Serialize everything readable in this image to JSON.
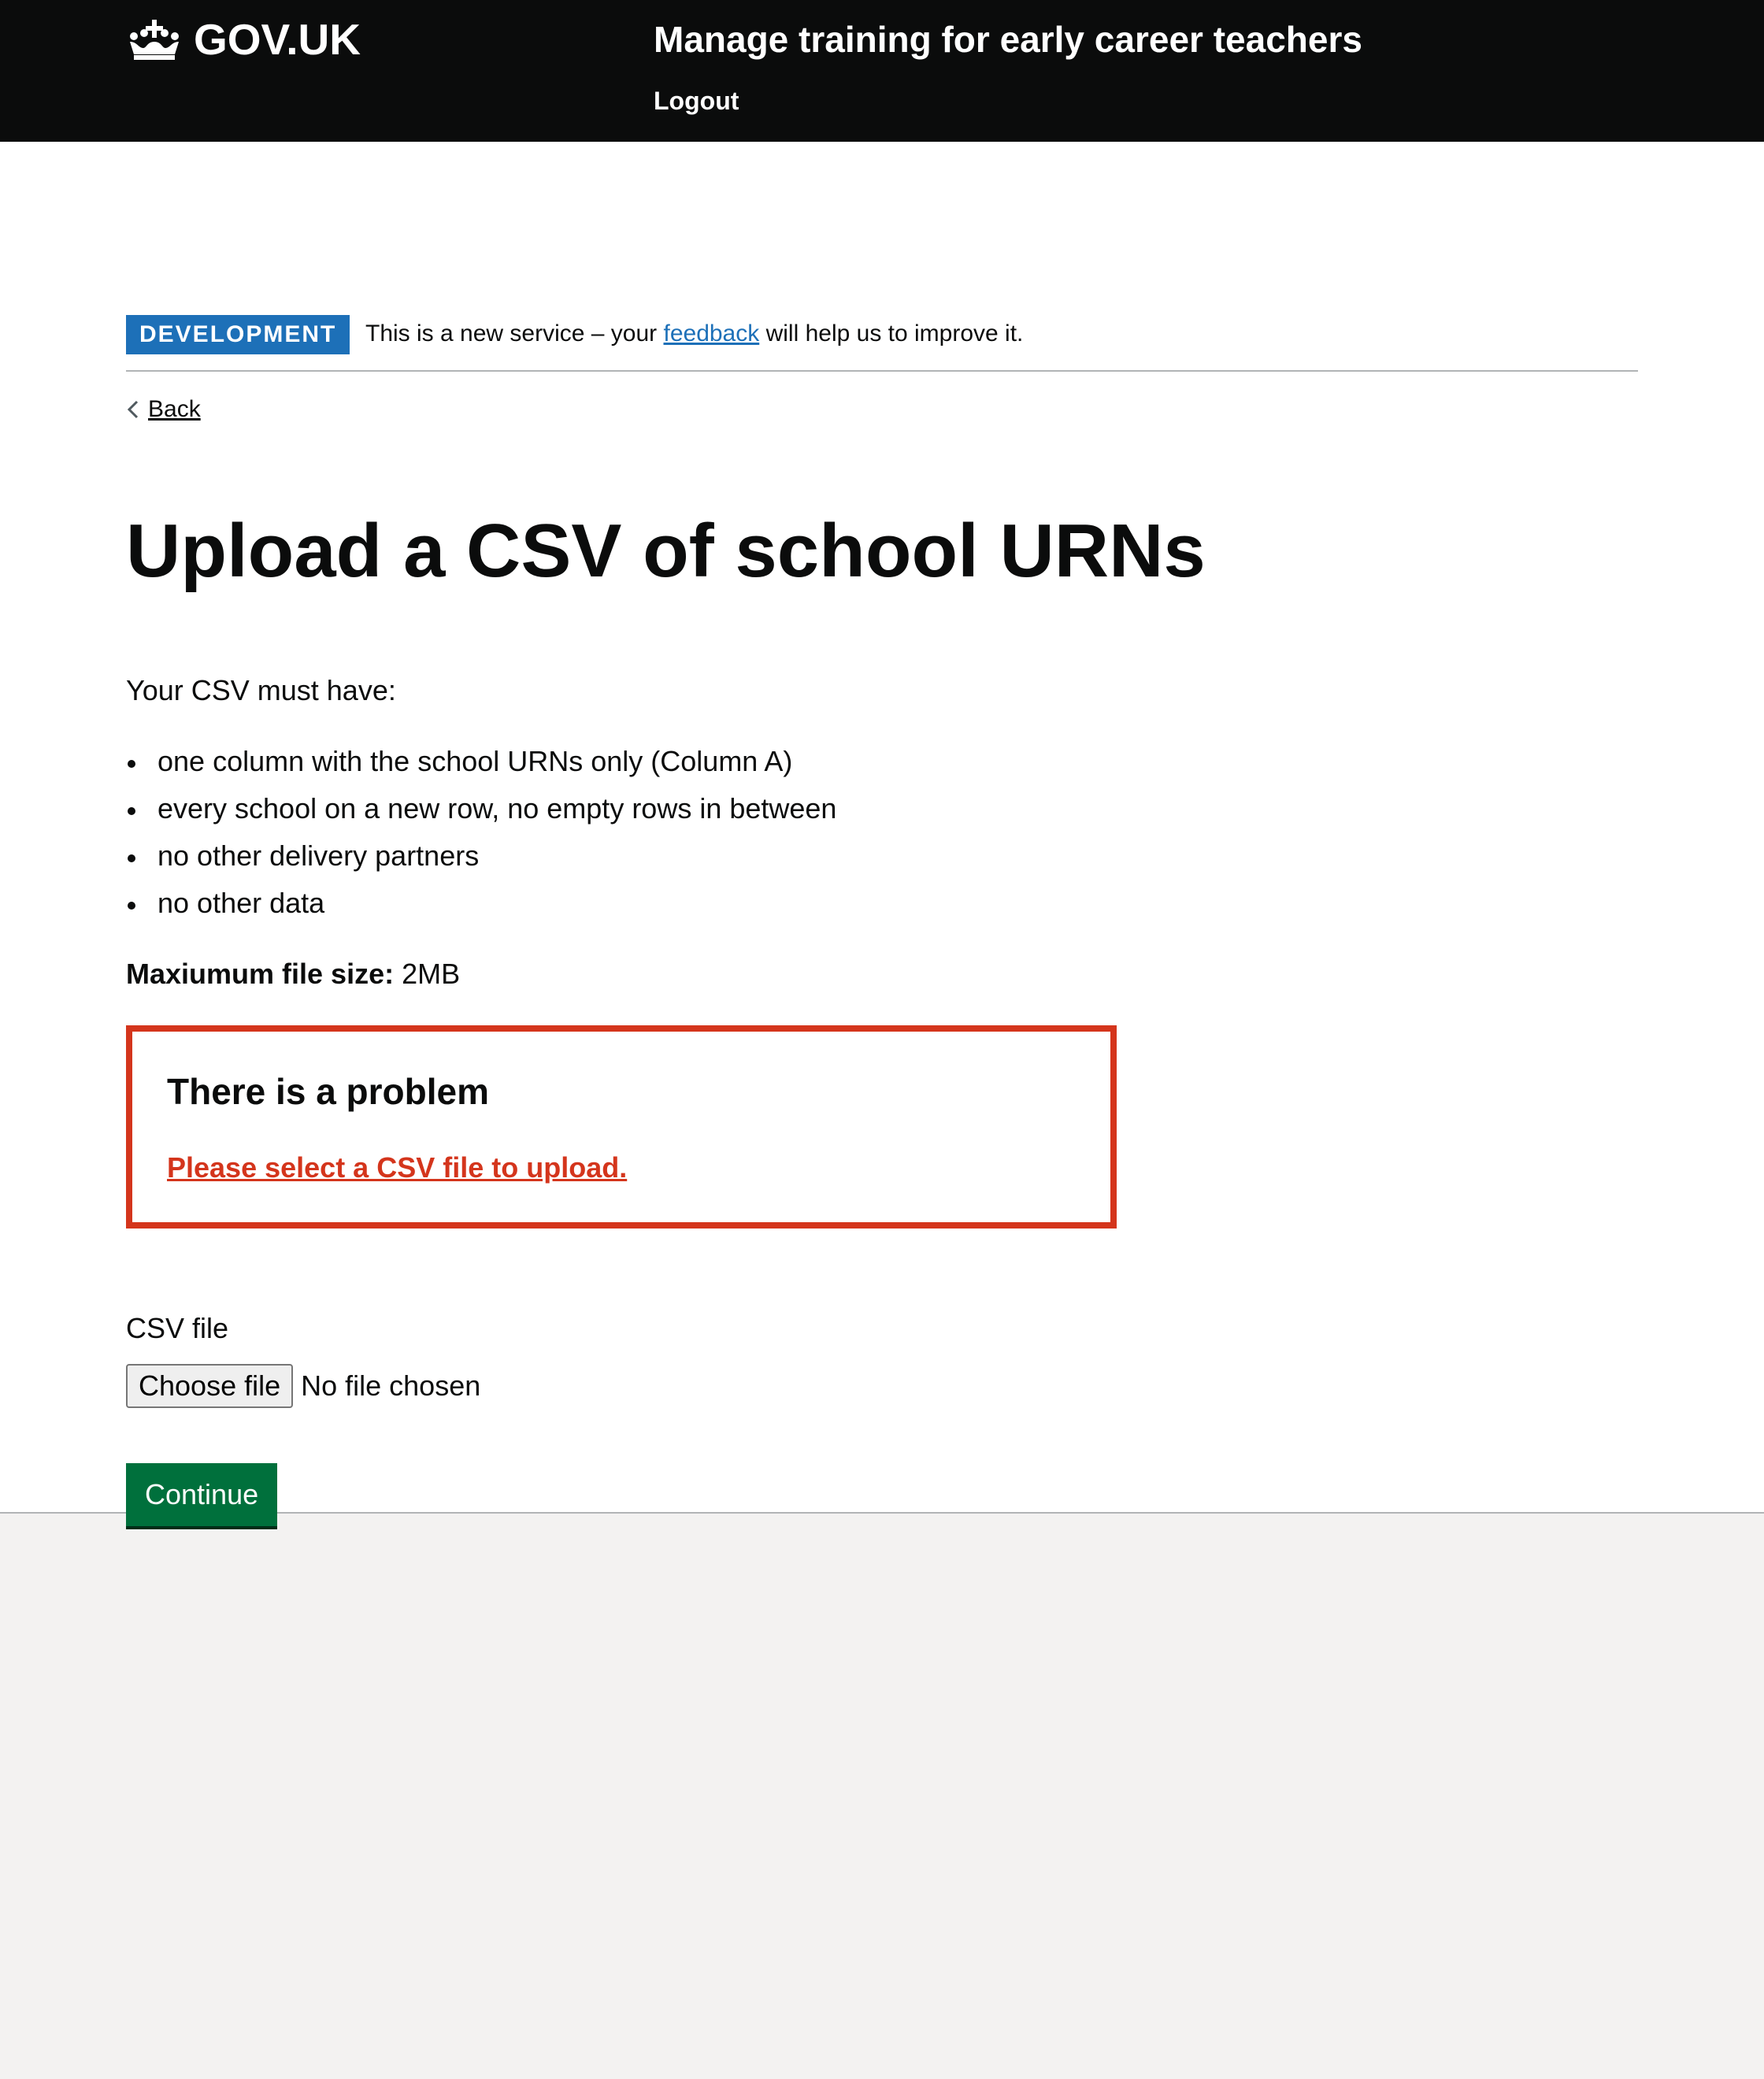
{
  "header": {
    "logo_text": "GOV.UK",
    "service_name": "Manage training for early career teachers",
    "logout_label": "Logout"
  },
  "phase_banner": {
    "tag": "DEVELOPMENT",
    "text_before": "This is a new service – your ",
    "feedback_link": "feedback",
    "text_after": " will help us to improve it."
  },
  "back_link": "Back",
  "page": {
    "title": "Upload a CSV of school URNs",
    "intro": "Your CSV must have:",
    "requirements": [
      "one column with the school URNs only (Column A)",
      "every school on a new row, no empty rows in between",
      "no other delivery partners",
      "no other data"
    ],
    "max_size_label": "Maxiumum file size:",
    "max_size_value": " 2MB"
  },
  "error_summary": {
    "title": "There is a problem",
    "message": "Please select a CSV file to upload."
  },
  "file_upload": {
    "label": "CSV file",
    "button_label": "Choose file",
    "status": "No file chosen"
  },
  "continue_label": "Continue",
  "colors": {
    "header_background": "#0b0c0c",
    "brand_blue": "#1d70b8",
    "error_red": "#d4351c",
    "button_green": "#00703c",
    "footer_background": "#f3f2f1"
  },
  "icons": {
    "logo": "crown-icon",
    "back": "chevron-left-icon"
  }
}
